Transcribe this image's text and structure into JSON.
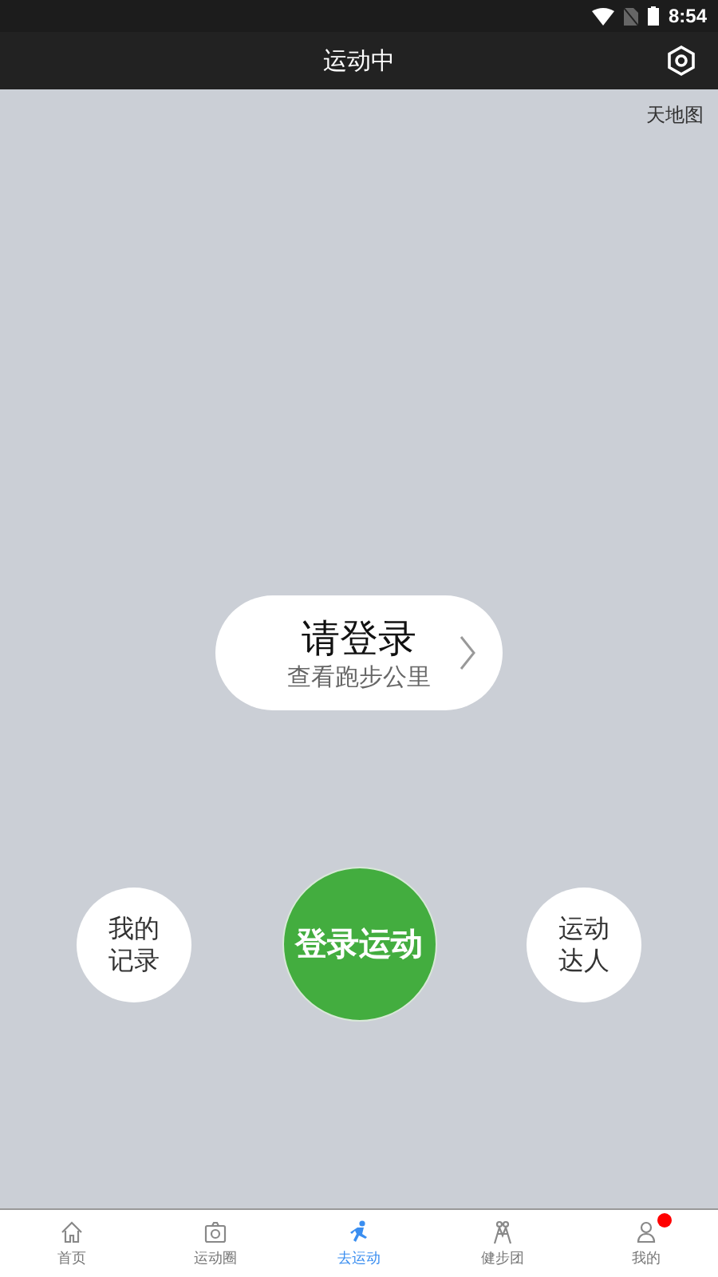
{
  "status_bar": {
    "time": "8:54"
  },
  "header": {
    "title": "运动中"
  },
  "map": {
    "attribution": "天地图"
  },
  "login_card": {
    "title": "请登录",
    "subtitle": "查看跑步公里"
  },
  "actions": [
    {
      "kind": "side",
      "lines": [
        "我的",
        "记录"
      ]
    },
    {
      "kind": "main",
      "lines": [
        "登录运动"
      ]
    },
    {
      "kind": "side",
      "lines": [
        "运动",
        "达人"
      ]
    }
  ],
  "tabs": [
    {
      "kind": "home",
      "label": "首页",
      "selected": false,
      "badge": false
    },
    {
      "kind": "camera",
      "label": "运动圈",
      "selected": false,
      "badge": false
    },
    {
      "kind": "run",
      "label": "去运动",
      "selected": true,
      "badge": false
    },
    {
      "kind": "group",
      "label": "健步团",
      "selected": false,
      "badge": false
    },
    {
      "kind": "user",
      "label": "我的",
      "selected": false,
      "badge": true
    }
  ]
}
